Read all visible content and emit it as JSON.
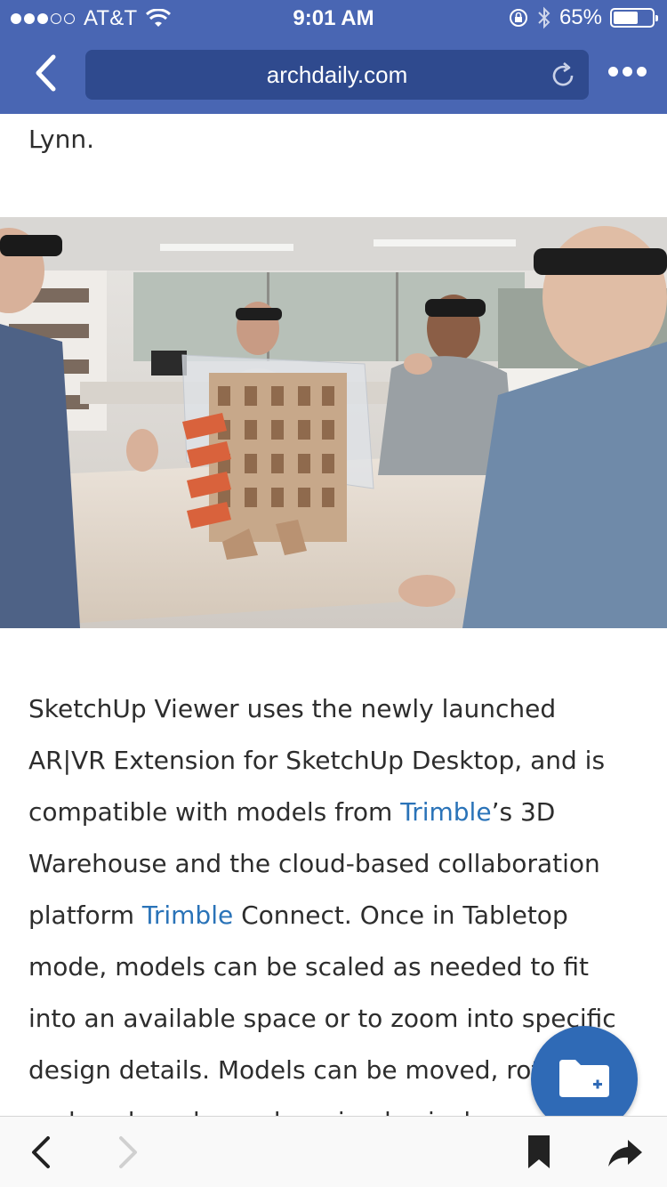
{
  "status_bar": {
    "carrier": "AT&T",
    "time": "9:01 AM",
    "battery": "65%",
    "battery_level": 0.65,
    "icons": [
      "signal-dots-icon",
      "wifi-icon",
      "lock-rotation-icon",
      "bluetooth-icon",
      "battery-icon"
    ]
  },
  "browser": {
    "url": "archdaily.com",
    "icons": [
      "back-chevron-icon",
      "reload-icon",
      "more-dots-icon"
    ]
  },
  "article": {
    "intro_tail": "Lynn.",
    "photo_alt_icon": "ar-hologram-building-photo",
    "body": {
      "s1": "SketchUp Viewer uses the newly launched AR|VR Extension for SketchUp Desktop, and is compatible with models from ",
      "link1": "Trimble",
      "s2": "’s 3D Warehouse and the cloud-based collaboration platform ",
      "link2": "Trimble",
      "s3": " Connect. Once in Tabletop mode, models can be scaled as needed to fit into an available space or to zoom into specific design details. Models can be moved, rotated and anchored anywhere in physical space."
    }
  },
  "fab": {
    "icon": "add-to-folder-icon"
  },
  "toolbar": {
    "icons": [
      "back-arrow-icon",
      "forward-arrow-icon",
      "bookmark-icon",
      "share-icon"
    ]
  },
  "colors": {
    "chrome": "#4966b3",
    "urlbox": "#2f4a8e",
    "link": "#2a73b8",
    "fab": "#2f6ab6"
  }
}
